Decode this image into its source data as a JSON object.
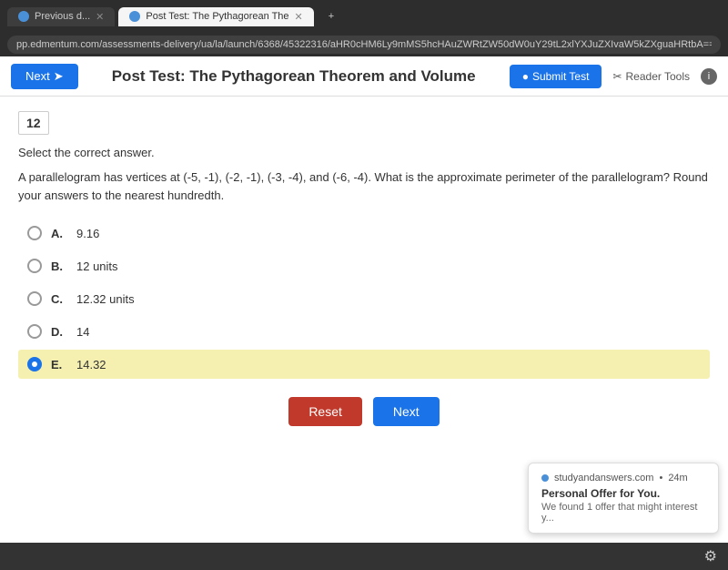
{
  "browser": {
    "tabs": [
      {
        "id": "prev",
        "label": "Previous d...",
        "active": false,
        "icon": true
      },
      {
        "id": "post-test",
        "label": "Post Test: The Pythagorean The",
        "active": true,
        "icon": true
      }
    ],
    "address": "pp.edmentum.com/assessments-delivery/ua/la/launch/6368/45322316/aHR0cHM6Ly9mMS5hcHAuZWRtZW50dW0uY29tL2xlYXJuZXIvaW5kZXguaHRtbA==",
    "new_tab_icon": "+"
  },
  "header": {
    "next_label": "Next",
    "title": "Post Test: The Pythagorean Theorem and Volume",
    "submit_test_label": "Submit Test",
    "reader_tools_label": "Reader Tools",
    "info_label": "i"
  },
  "question": {
    "number": "12",
    "instruction": "Select the correct answer.",
    "text": "A parallelogram has vertices at (-5, -1), (-2, -1), (-3, -4), and (-6, -4). What is the approximate perimeter of the parallelogram? Round your answers to the nearest hundredth.",
    "choices": [
      {
        "id": "A",
        "text": "9.16",
        "selected": false
      },
      {
        "id": "B",
        "text": "12 units",
        "selected": false
      },
      {
        "id": "C",
        "text": "12.32 units",
        "selected": false
      },
      {
        "id": "D",
        "text": "14",
        "selected": false
      },
      {
        "id": "E",
        "text": "14.32",
        "selected": true
      }
    ],
    "reset_label": "Reset",
    "next_label": "Next"
  },
  "notification": {
    "source": "studyandanswers.com",
    "time": "24m",
    "title": "Personal Offer for You.",
    "text": "We found 1 offer that might interest y..."
  }
}
